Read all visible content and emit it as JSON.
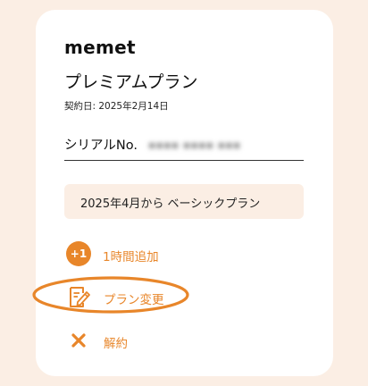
{
  "account": {
    "app_name": "memet",
    "plan_name": "プレミアムプラン",
    "contract_date": "契約日: 2025年2月14日",
    "serial_label": "シリアルNo.",
    "serial_value": "▪▪▪▪ ▪▪▪▪ ▪▪▪"
  },
  "notice": {
    "text": "2025年4月から ベーシックプラン"
  },
  "menu": {
    "add_time": {
      "badge": "+1",
      "label": "1時間追加"
    },
    "change_plan": {
      "label": "プラン変更"
    },
    "cancel": {
      "label": "解約"
    }
  },
  "colors": {
    "accent": "#e8862a",
    "page_background": "#fbeee4",
    "card": "#ffffff",
    "notice_background": "#fbeee4"
  },
  "icons": {
    "add_time": "plus-one-icon",
    "change_plan": "edit-document-icon",
    "cancel": "close-icon"
  }
}
